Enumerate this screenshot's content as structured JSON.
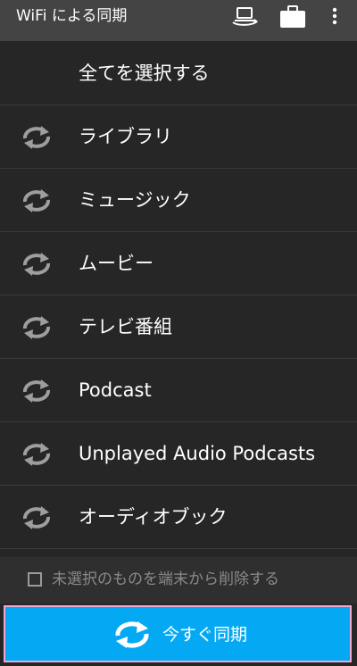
{
  "header": {
    "title": "WiFi による同期",
    "icons": [
      "laptop-sync-icon",
      "briefcase-icon",
      "overflow-menu-icon"
    ]
  },
  "list": {
    "select_all": "全てを選択する",
    "items": [
      {
        "label": "ライブラリ",
        "icon": "sync-icon"
      },
      {
        "label": "ミュージック",
        "icon": "sync-icon"
      },
      {
        "label": "ムービー",
        "icon": "sync-icon"
      },
      {
        "label": "テレビ番組",
        "icon": "sync-icon"
      },
      {
        "label": "Podcast",
        "icon": "sync-icon"
      },
      {
        "label": "Unplayed Audio Podcasts",
        "icon": "sync-icon"
      },
      {
        "label": "オーディオブック",
        "icon": "sync-icon"
      }
    ]
  },
  "footer": {
    "delete_unselected_label": "未選択のものを端末から削除する",
    "delete_unselected_checked": false,
    "sync_now_label": "今すぐ同期"
  },
  "colors": {
    "background": "#262626",
    "topbar": "#444444",
    "button": "#05a9f3",
    "button_border": "#f0a8cf"
  }
}
